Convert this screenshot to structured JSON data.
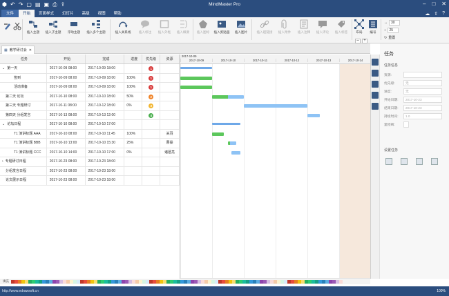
{
  "app": {
    "title": "MindMaster Pro"
  },
  "menu": [
    "文件",
    "开始",
    "页面样式",
    "幻灯片",
    "高级",
    "视图",
    "帮助"
  ],
  "ribbon": {
    "buttons": [
      {
        "label": "插入主题",
        "icon": "topic-icon"
      },
      {
        "label": "插入子主题",
        "icon": "subtopic-icon"
      },
      {
        "label": "浮动主题",
        "icon": "floating-topic-icon"
      },
      {
        "label": "插入多个主题",
        "icon": "multi-topic-icon"
      },
      {
        "label": "插入关系线",
        "icon": "relationship-icon"
      },
      {
        "label": "插入标注",
        "icon": "callout-icon"
      },
      {
        "label": "插入外框",
        "icon": "boundary-icon"
      },
      {
        "label": "插入概要",
        "icon": "summary-icon"
      },
      {
        "label": "插入图标",
        "icon": "mark-icon"
      },
      {
        "label": "插入剪贴画",
        "icon": "clipart-icon"
      },
      {
        "label": "插入图片",
        "icon": "picture-icon"
      },
      {
        "label": "插入超链接",
        "icon": "hyperlink-icon"
      },
      {
        "label": "插入附件",
        "icon": "attachment-icon"
      },
      {
        "label": "插入注释",
        "icon": "note-icon"
      },
      {
        "label": "插入评论",
        "icon": "comment-icon"
      },
      {
        "label": "插入标签",
        "icon": "tag-icon"
      },
      {
        "label": "布局",
        "icon": "layout-icon"
      },
      {
        "label": "编号",
        "icon": "numbering-icon"
      }
    ],
    "spacing": {
      "h": "30",
      "v": "25",
      "reset": "重置"
    }
  },
  "doc_tab": {
    "label": "教学研讨会"
  },
  "grid": {
    "headers": [
      "任务",
      "开始",
      "完成",
      "进度",
      "优先级",
      "资源"
    ],
    "rows": [
      {
        "task": "第一天",
        "start": "2017-10-09 08:00",
        "end": "2017-10-09 18:00",
        "progress": "",
        "priority": "1",
        "resource": "",
        "level": 0,
        "expand": "⌄"
      },
      {
        "task": "签到",
        "start": "2017-10-09 08:00",
        "end": "2017-10-09 18:00",
        "progress": "100%",
        "priority": "1",
        "resource": "",
        "level": 1
      },
      {
        "task": "活动准备",
        "start": "2017-10-09 08:00",
        "end": "2017-10-09 18:00",
        "progress": "100%",
        "priority": "1",
        "resource": "",
        "level": 1
      },
      {
        "task": "第二天 论坛",
        "start": "2017-10-10 08:00",
        "end": "2017-10-10 18:00",
        "progress": "50%",
        "priority": "2",
        "resource": "",
        "level": 0
      },
      {
        "task": "第三天 专题研讨",
        "start": "2017-10-11 08:00",
        "end": "2017-10-12 18:00",
        "progress": "0%",
        "priority": "3",
        "resource": "",
        "level": 0
      },
      {
        "task": "第四天 分组发言",
        "start": "2017-10-13 08:00",
        "end": "2017-10-13 12:00",
        "progress": "",
        "priority": "4",
        "resource": "",
        "level": 0
      },
      {
        "task": "论坛日程",
        "start": "2017-10-10 08:00",
        "end": "2017-10-10 17:00",
        "progress": "",
        "priority": "",
        "resource": "",
        "level": 0,
        "expand": "⌄"
      },
      {
        "task": "T1 演讲标题 AAA",
        "start": "2017-10-10 08:00",
        "end": "2017-10-10 11:45",
        "progress": "100%",
        "priority": "",
        "resource": "关羽",
        "level": 1
      },
      {
        "task": "T1 演讲标题 BBB",
        "start": "2017-10-10 13:00",
        "end": "2017-10-10 15:30",
        "progress": "25%",
        "priority": "",
        "resource": "曹操",
        "level": 1
      },
      {
        "task": "T1 演讲标题 CCC",
        "start": "2017-10-10 14:00",
        "end": "2017-10-10 17:00",
        "progress": "0%",
        "priority": "",
        "resource": "诸葛亮",
        "level": 1
      },
      {
        "task": "专题研讨日程",
        "start": "2017-10-23 08:00",
        "end": "2017-10-23 18:00",
        "progress": "",
        "priority": "",
        "resource": "",
        "level": 0,
        "expand": "›"
      },
      {
        "task": "分组发言日程",
        "start": "2017-10-23 08:00",
        "end": "2017-10-23 18:00",
        "progress": "",
        "priority": "",
        "resource": "",
        "level": 0
      },
      {
        "task": "论文展示日程",
        "start": "2017-10-23 08:00",
        "end": "2017-10-23 18:00",
        "progress": "",
        "priority": "",
        "resource": "",
        "level": 0
      }
    ]
  },
  "gantt": {
    "month": "2017-10-09",
    "days": [
      "2017-10-09",
      "2017-10-10",
      "2017-10-11",
      "2017-10-12",
      "2017-10-13",
      "2017-10-14"
    ],
    "colors": {
      "done": "#5cc75c",
      "todo": "#8ec3f5",
      "summary": "#6ea8e8"
    }
  },
  "priority_colors": {
    "1": "#d83a3a",
    "2": "#f0852a",
    "3": "#f2b632",
    "4": "#4caf50"
  },
  "panel": {
    "title": "任务",
    "section": "任务信息",
    "fields": [
      {
        "label": "资源:",
        "value": ""
      },
      {
        "label": "优先级:",
        "value": "无"
      },
      {
        "label": "进度:",
        "value": "无"
      },
      {
        "label": "开始日期:",
        "value": "2017-10-23"
      },
      {
        "label": "结束日期:",
        "value": "2017-10-23"
      },
      {
        "label": "持续时间:",
        "value": "1.0"
      },
      {
        "label": "里程碑:",
        "value": ""
      }
    ],
    "add_title": "设置任务"
  },
  "status": {
    "url": "http://www.edrawsoft.cn",
    "zoom": "100%",
    "palette_label": "填充"
  }
}
